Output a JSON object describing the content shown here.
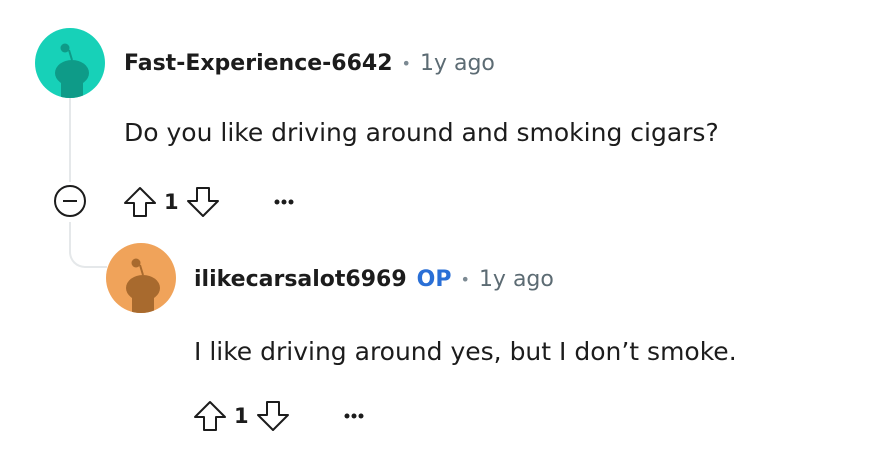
{
  "comment": {
    "author": "Fast-Experience-6642",
    "separator": "•",
    "time": "1y ago",
    "text": "Do you like driving around and smoking cigars?",
    "score": "1",
    "avatar_color": "#17d1b8"
  },
  "reply": {
    "author": "ilikecarsalot6969",
    "op_badge": "OP",
    "separator": "•",
    "time": "1y ago",
    "text": "I like driving around yes, but I don’t smoke.",
    "score": "1",
    "avatar_color": "#f0a35a"
  },
  "icons": {
    "upvote": "upvote-arrow-icon",
    "downvote": "downvote-arrow-icon",
    "more": "ellipsis-icon",
    "collapse": "collapse-minus-icon"
  },
  "colors": {
    "op_badge": "#2a6fd6",
    "thread_line": "#e5e8ea"
  }
}
